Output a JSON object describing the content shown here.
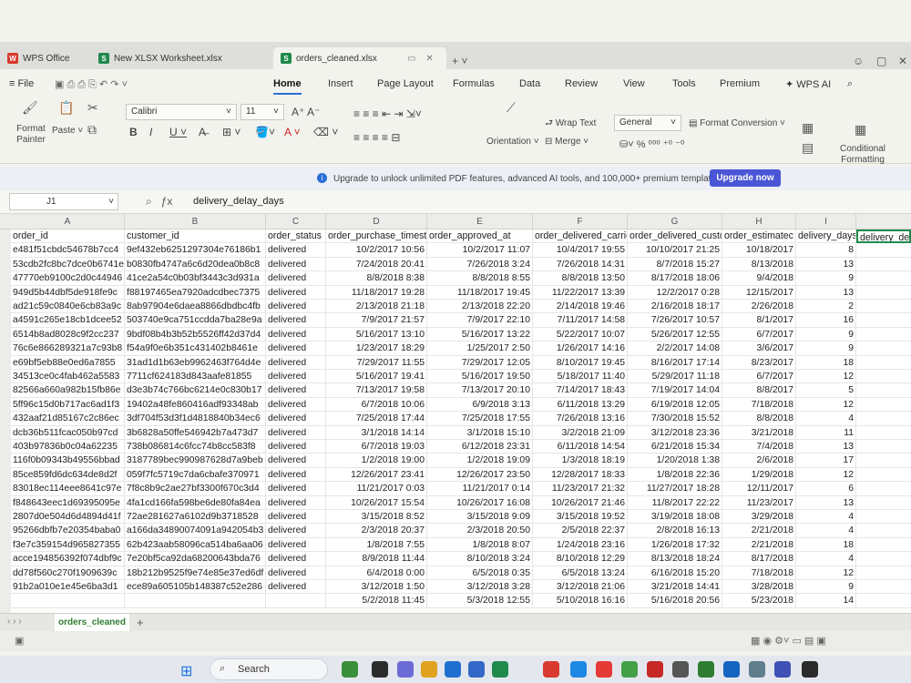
{
  "tabs": [
    {
      "label": "WPS Office",
      "color": "#d93a2f",
      "glyph": "W"
    },
    {
      "label": "New XLSX Worksheet.xlsx",
      "color": "#1f8a4c",
      "glyph": "S"
    },
    {
      "label": "orders_cleaned.xlsx",
      "color": "#1f8a4c",
      "glyph": "S"
    }
  ],
  "menu": {
    "file": "File",
    "items": [
      "Home",
      "Insert",
      "Page Layout",
      "Formulas",
      "Data",
      "Review",
      "View",
      "Tools",
      "Premium",
      "WPS AI"
    ]
  },
  "ribbon": {
    "format_painter": "Format Painter",
    "paste": "Paste",
    "font": "Calibri",
    "size": "11",
    "wrap": "Wrap Text",
    "merge": "Merge",
    "orientation": "Orientation",
    "number_format": "General",
    "format_conversion": "Format Conversion",
    "conditional": "Conditional Formatting"
  },
  "banner": {
    "message": "Upgrade to unlock unlimited PDF features, advanced AI tools, and 100,000+ premium templates.",
    "button": "Upgrade now"
  },
  "formula_bar": {
    "name_box": "J1",
    "formula": "delivery_delay_days"
  },
  "columns": [
    "A",
    "B",
    "C",
    "D",
    "E",
    "F",
    "G",
    "H",
    "I"
  ],
  "headers": [
    "order_id",
    "customer_id",
    "order_status",
    "order_purchase_timest",
    "order_approved_at",
    "order_delivered_carrie",
    "order_delivered_custo",
    "order_estimatec",
    "delivery_days",
    "delivery_de"
  ],
  "rows": [
    [
      "e481f51cbdc54678b7cc4",
      "9ef432eb6251297304e76186b1",
      "delivered",
      "10/2/2017 10:56",
      "10/2/2017 11:07",
      "10/4/2017 19:55",
      "10/10/2017 21:25",
      "10/18/2017",
      "8"
    ],
    [
      "53cdb2fc8bc7dce0b6741e",
      "b0830fb4747a6c6d20dea0b8c8",
      "delivered",
      "7/24/2018 20:41",
      "7/26/2018 3:24",
      "7/26/2018 14:31",
      "8/7/2018 15:27",
      "8/13/2018",
      "13"
    ],
    [
      "47770eb9100c2d0c44946",
      "41ce2a54c0b03bf3443c3d931a",
      "delivered",
      "8/8/2018 8:38",
      "8/8/2018 8:55",
      "8/8/2018 13:50",
      "8/17/2018 18:06",
      "9/4/2018",
      "9"
    ],
    [
      "949d5b44dbf5de918fe9c",
      "f88197465ea7920adcdbec7375",
      "delivered",
      "11/18/2017 19:28",
      "11/18/2017 19:45",
      "11/22/2017 13:39",
      "12/2/2017 0:28",
      "12/15/2017",
      "13"
    ],
    [
      "ad21c59c0840e6cb83a9c",
      "8ab97904e6daea8866dbdbc4fb",
      "delivered",
      "2/13/2018 21:18",
      "2/13/2018 22:20",
      "2/14/2018 19:46",
      "2/16/2018 18:17",
      "2/26/2018",
      "2"
    ],
    [
      "a4591c265e18cb1dcee52",
      "503740e9ca751ccdda7ba28e9a",
      "delivered",
      "7/9/2017 21:57",
      "7/9/2017 22:10",
      "7/11/2017 14:58",
      "7/26/2017 10:57",
      "8/1/2017",
      "16"
    ],
    [
      "6514b8ad8028c9f2cc237",
      "9bdf08b4b3b52b5526ff42d37d4",
      "delivered",
      "5/16/2017 13:10",
      "5/16/2017 13:22",
      "5/22/2017 10:07",
      "5/26/2017 12:55",
      "6/7/2017",
      "9"
    ],
    [
      "76c6e866289321a7c93b8",
      "f54a9f0e6b351c431402b8461e",
      "delivered",
      "1/23/2017 18:29",
      "1/25/2017 2:50",
      "1/26/2017 14:16",
      "2/2/2017 14:08",
      "3/6/2017",
      "9"
    ],
    [
      "e69bf5eb88e0ed6a7855",
      "31ad1d1b63eb9962463f764d4e",
      "delivered",
      "7/29/2017 11:55",
      "7/29/2017 12:05",
      "8/10/2017 19:45",
      "8/16/2017 17:14",
      "8/23/2017",
      "18"
    ],
    [
      "34513ce0c4fab462a5583",
      "7711cf624183d843aafe81855",
      "delivered",
      "5/16/2017 19:41",
      "5/16/2017 19:50",
      "5/18/2017 11:40",
      "5/29/2017 11:18",
      "6/7/2017",
      "12"
    ],
    [
      "82566a660a982b15fb86e",
      "d3e3b74c766bc6214e0c830b17",
      "delivered",
      "7/13/2017 19:58",
      "7/13/2017 20:10",
      "7/14/2017 18:43",
      "7/19/2017 14:04",
      "8/8/2017",
      "5"
    ],
    [
      "5ff96c15d0b717ac6ad1f3",
      "19402a48fe860416adf93348ab",
      "delivered",
      "6/7/2018 10:06",
      "6/9/2018 3:13",
      "6/11/2018 13:29",
      "6/19/2018 12:05",
      "7/18/2018",
      "12"
    ],
    [
      "432aaf21d85167c2c86ec",
      "3df704f53d3f1d4818840b34ec6",
      "delivered",
      "7/25/2018 17:44",
      "7/25/2018 17:55",
      "7/26/2018 13:16",
      "7/30/2018 15:52",
      "8/8/2018",
      "4"
    ],
    [
      "dcb36b511fcac050b97cd",
      "3b6828a50ffe546942b7a473d7",
      "delivered",
      "3/1/2018 14:14",
      "3/1/2018 15:10",
      "3/2/2018 21:09",
      "3/12/2018 23:36",
      "3/21/2018",
      "11"
    ],
    [
      "403b97836b0c04a62235",
      "738b086814c6fcc74b8cc583f8",
      "delivered",
      "6/7/2018 19:03",
      "6/12/2018 23:31",
      "6/11/2018 14:54",
      "6/21/2018 15:34",
      "7/4/2018",
      "13"
    ],
    [
      "116f0b09343b49556bbad",
      "3187789bec990987628d7a9beb",
      "delivered",
      "1/2/2018 19:00",
      "1/2/2018 19:09",
      "1/3/2018 18:19",
      "1/20/2018 1:38",
      "2/6/2018",
      "17"
    ],
    [
      "85ce859fd6dc634de8d2f",
      "059f7fc5719c7da6cbafe370971",
      "delivered",
      "12/26/2017 23:41",
      "12/26/2017 23:50",
      "12/28/2017 18:33",
      "1/8/2018 22:36",
      "1/29/2018",
      "12"
    ],
    [
      "83018ec114eee8641c97e",
      "7f8c8b9c2ae27bf3300f670c3d4",
      "delivered",
      "11/21/2017 0:03",
      "11/21/2017 0:14",
      "11/23/2017 21:32",
      "11/27/2017 18:28",
      "12/11/2017",
      "6"
    ],
    [
      "f848643eec1d69395095e",
      "4fa1cd166fa598be6de80fa84ea",
      "delivered",
      "10/26/2017 15:54",
      "10/26/2017 16:08",
      "10/26/2017 21:46",
      "11/8/2017 22:22",
      "11/23/2017",
      "13"
    ],
    [
      "2807d0e504d6d4894d41f",
      "72ae281627a6102d9b3718528",
      "delivered",
      "3/15/2018 8:52",
      "3/15/2018 9:09",
      "3/15/2018 19:52",
      "3/19/2018 18:08",
      "3/29/2018",
      "4"
    ],
    [
      "95266dbfb7e20354baba0",
      "a166da34890074091a942054b3",
      "delivered",
      "2/3/2018 20:37",
      "2/3/2018 20:50",
      "2/5/2018 22:37",
      "2/8/2018 16:13",
      "2/21/2018",
      "4"
    ],
    [
      "f3e7c359154d965827355",
      "62b423aab58096ca514ba6aa06",
      "delivered",
      "1/8/2018 7:55",
      "1/8/2018 8:07",
      "1/24/2018 23:16",
      "1/26/2018 17:32",
      "2/21/2018",
      "18"
    ],
    [
      "acce194856392f074dbf9c",
      "7e20bf5ca92da68200643bda76",
      "delivered",
      "8/9/2018 11:44",
      "8/10/2018 3:24",
      "8/10/2018 12:29",
      "8/13/2018 18:24",
      "8/17/2018",
      "4"
    ],
    [
      "dd78f560c270f1909639c",
      "18b212b9525f9e74e85e37ed6df",
      "delivered",
      "6/4/2018 0:00",
      "6/5/2018 0:35",
      "6/5/2018 13:24",
      "6/16/2018 15:20",
      "7/18/2018",
      "12"
    ],
    [
      "91b2a010e1e45e6ba3d1",
      "ece89a605105b148387c52e286",
      "delivered",
      "3/12/2018 1:50",
      "3/12/2018 3:28",
      "3/12/2018 21:06",
      "3/21/2018 14:41",
      "3/28/2018",
      "9"
    ],
    [
      "",
      "",
      "",
      "5/2/2018 11:45",
      "5/3/2018 12:55",
      "5/10/2018 16:16",
      "5/16/2018 20:56",
      "5/23/2018",
      "14"
    ]
  ],
  "sheet": {
    "tab": "orders_cleaned",
    "add": "+"
  },
  "taskbar": {
    "search": "Search"
  }
}
